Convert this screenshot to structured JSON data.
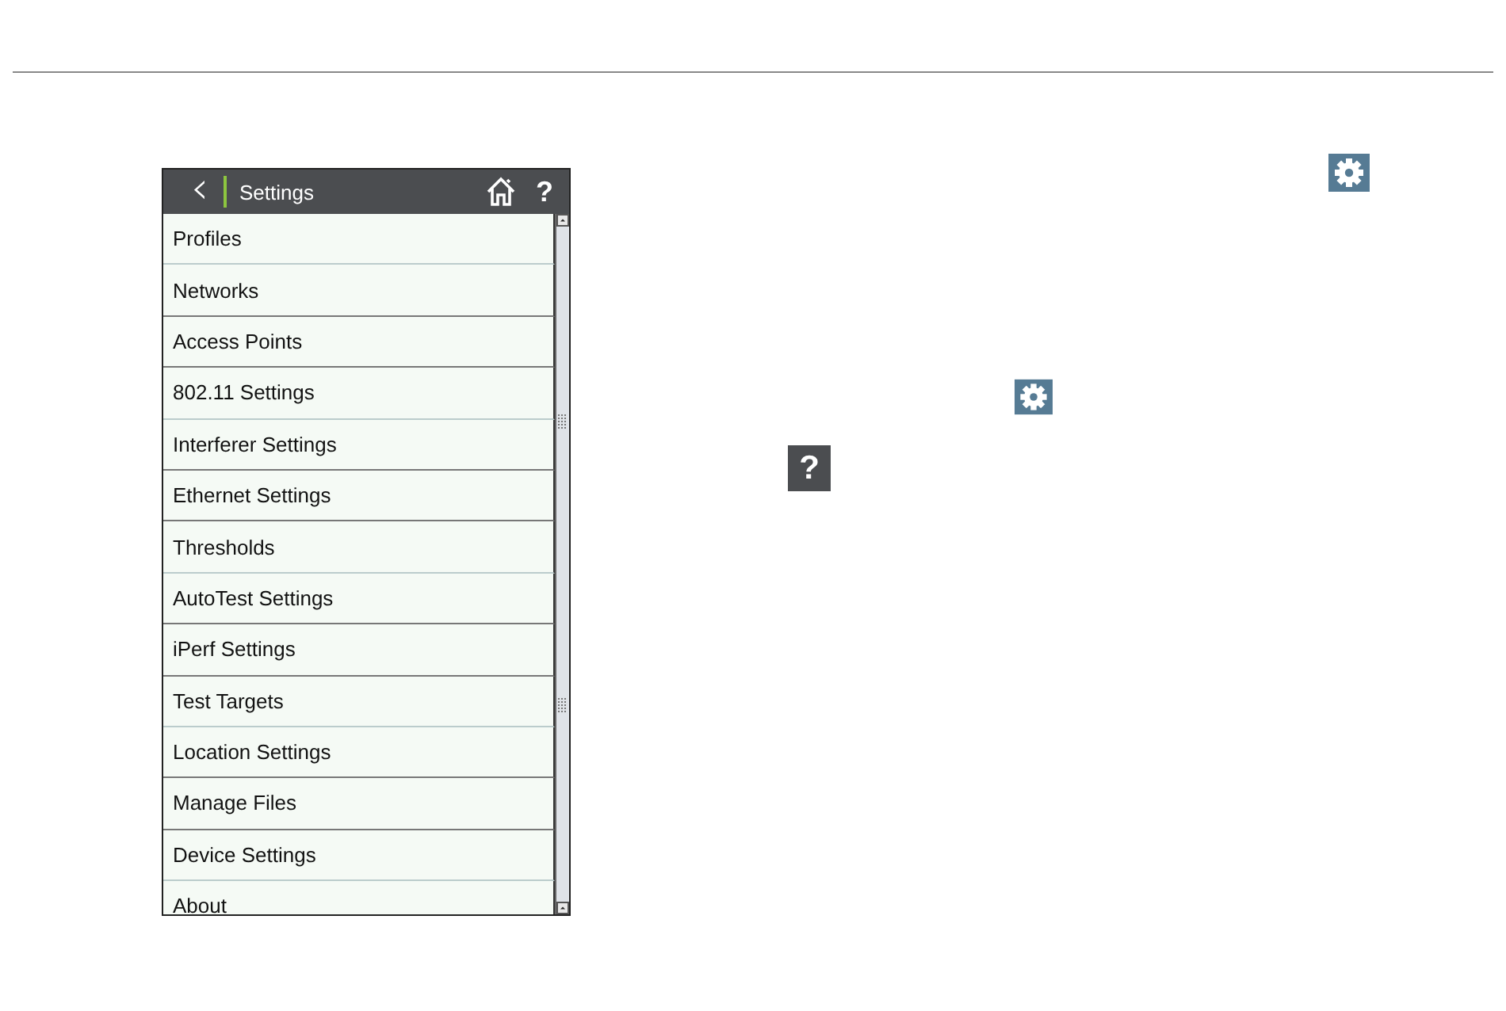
{
  "header": {
    "back": "‹",
    "title": "Settings",
    "help": "?"
  },
  "items": [
    {
      "label": "Profiles"
    },
    {
      "label": "Networks"
    },
    {
      "label": "Access Points"
    },
    {
      "label": "802.11 Settings"
    },
    {
      "label": "Interferer Settings"
    },
    {
      "label": "Ethernet Settings"
    },
    {
      "label": "Thresholds"
    },
    {
      "label": "AutoTest Settings"
    },
    {
      "label": "iPerf Settings"
    },
    {
      "label": "Test Targets"
    },
    {
      "label": "Location Settings"
    },
    {
      "label": "Manage Files"
    },
    {
      "label": "Device Settings"
    },
    {
      "label": "About"
    }
  ],
  "inline_help": "?"
}
